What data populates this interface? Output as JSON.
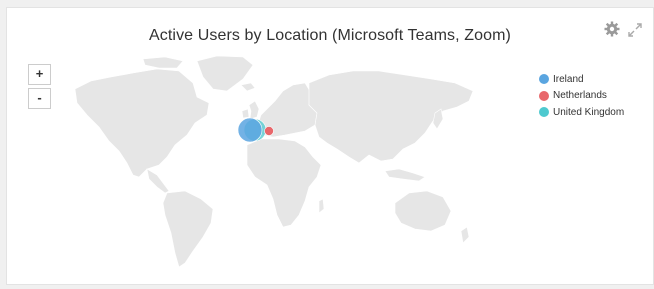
{
  "widget": {
    "title": "Active Users by Location (Microsoft Teams, Zoom)"
  },
  "controls": {
    "zoom_in_label": "+",
    "zoom_out_label": "-",
    "settings_icon": "gear-icon",
    "expand_icon": "expand-icon"
  },
  "colors": {
    "land": "#e6e6e6",
    "ireland": "#5aa5e0",
    "netherlands": "#e8676b",
    "united_kingdom": "#4ec9cf"
  },
  "legend": [
    {
      "label": "Ireland",
      "color": "#5aa5e0"
    },
    {
      "label": "Netherlands",
      "color": "#e8676b"
    },
    {
      "label": "United Kingdom",
      "color": "#4ec9cf"
    }
  ]
}
